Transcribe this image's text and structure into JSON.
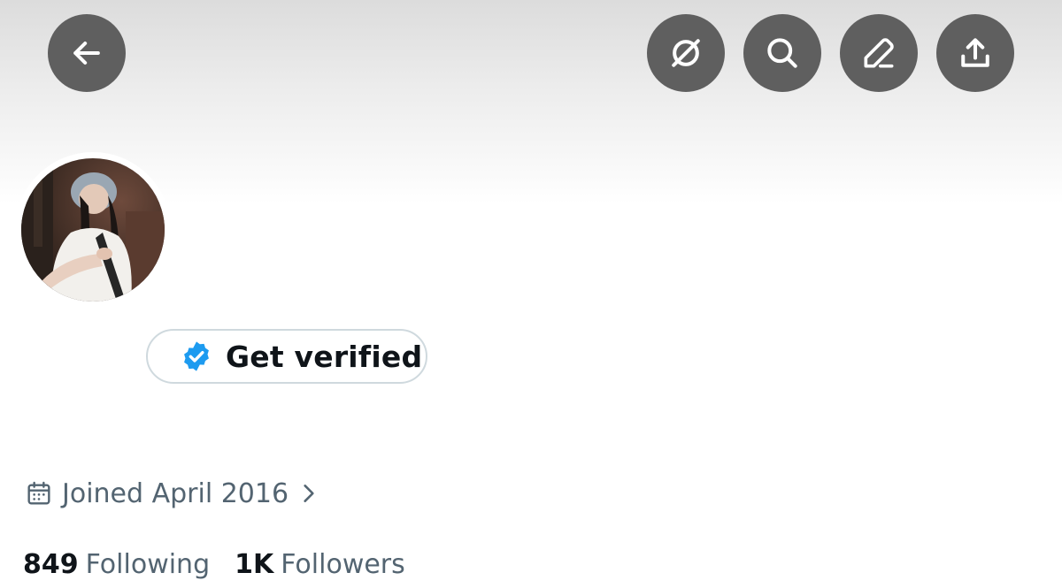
{
  "header": {
    "buttons": {
      "back": "arrow-left-icon",
      "grok": "grok-icon",
      "search": "search-icon",
      "edit": "pencil-icon",
      "share": "share-upload-icon"
    }
  },
  "profile": {
    "avatar": "profile-photo",
    "get_verified_label": "Get verified",
    "verified_badge_color": "#1d9bf0",
    "joined_text": "Joined April 2016",
    "following_count": "849",
    "following_label": "Following",
    "followers_count": "1K",
    "followers_label": "Followers"
  },
  "colors": {
    "icon_button_bg": "#5f5f5f",
    "secondary_text": "#536471",
    "primary_text": "#0f1419",
    "border": "#cfd9de"
  }
}
